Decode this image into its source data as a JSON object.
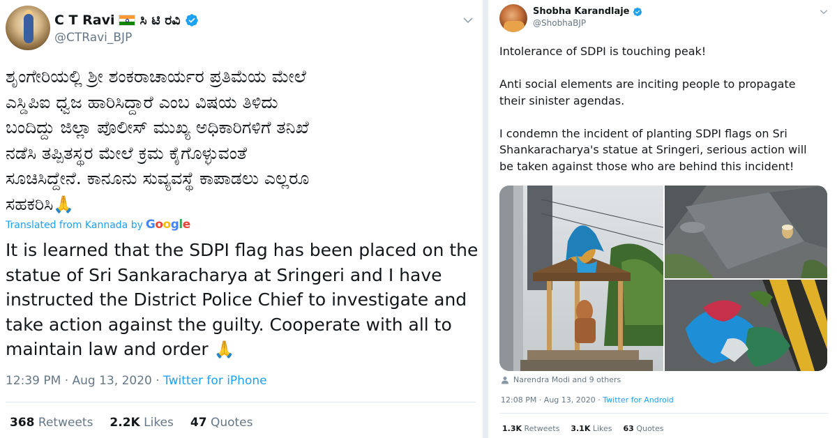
{
  "left_tweet": {
    "name": "C T Ravi",
    "name_kannada": "ಸಿ ಟಿ ರವಿ",
    "handle": "@CTRavi_BJP",
    "kannada_lines": [
      "ಶೃಂಗೇರಿಯಲ್ಲಿ ಶ್ರೀ ಶಂಕರಾಚಾರ್ಯರ ಪ್ರತಿಮೆಯ ಮೇಲೆ",
      "ಎಸ್ಡಿಪಿಐ ಧ್ವಜ ಹಾರಿಸಿದ್ದಾರೆ ಎಂಬ ವಿಷಯ ತಿಳಿದು",
      "ಬಂದಿದ್ದು ಜಿಲ್ಲಾ ಪೊಲೀಸ್ ಮುಖ್ಯ ಅಧಿಕಾರಿಗಳಿಗೆ ತನಿಖೆ",
      "ನಡೆಸಿ ತಪ್ಪಿತಸ್ಥರ ಮೇಲೆ ಕ್ರಮ ಕೈಗೊಳ್ಳುವಂತೆ",
      "ಸೂಚಿಸಿದ್ದೇನೆ. ಕಾನೂನು ಸುವ್ಯವಸ್ಥೆ ಕಾಪಾಡಲು ಎಲ್ಲರೂ",
      "ಸಹಕರಿಸಿ"
    ],
    "pray_emoji": "🙏",
    "translated_prefix": "Translated from Kannada by",
    "translator": "Google",
    "english_lines": [
      "It is learned that the SDPI flag has been placed on the",
      "statue of Sri Sankaracharya at Sringeri and I have",
      "instructed the District Police Chief to investigate and",
      "take action against the guilty. Cooperate with all to",
      "maintain law and order"
    ],
    "time": "12:39 PM · Aug 13, 2020 · ",
    "source": "Twitter for iPhone",
    "retweets_count": "368",
    "retweets_label": " Retweets",
    "likes_count": "2.2K",
    "likes_label": " Likes",
    "quotes_count": "47",
    "quotes_label": " Quotes",
    "icons": {
      "verified": "verified-badge-icon",
      "more": "chevron-down-icon",
      "flag": "india-flag-icon"
    }
  },
  "right_tweet": {
    "name": "Shobha Karandlaje",
    "handle": "@ShobhaBJP",
    "text_lines": [
      "Intolerance of SDPI is touching peak!",
      "",
      "Anti social elements are inciting people to propagate",
      "their sinister agendas.",
      "",
      "I condemn the incident of planting SDPI flags on Sri",
      "Shankaracharya's statue at Sringeri, serious action will",
      "be taken against those who are behind this incident!"
    ],
    "liked_by": "Narendra Modi and 9 others",
    "time": "12:08 PM · Aug 13, 2020 · ",
    "source": "Twitter for Android",
    "retweets_count": "1.3K",
    "retweets_label": " Retweets",
    "likes_count": "3.1K",
    "likes_label": " Likes",
    "quotes_count": "63",
    "quotes_label": " Quotes",
    "icons": {
      "verified": "verified-badge-icon",
      "more": "chevron-down-icon",
      "person": "person-icon"
    }
  },
  "colors": {
    "link_blue": "#1da1f2",
    "text_primary": "#14171a",
    "text_secondary": "#657786",
    "divider": "#e1e8ed"
  }
}
